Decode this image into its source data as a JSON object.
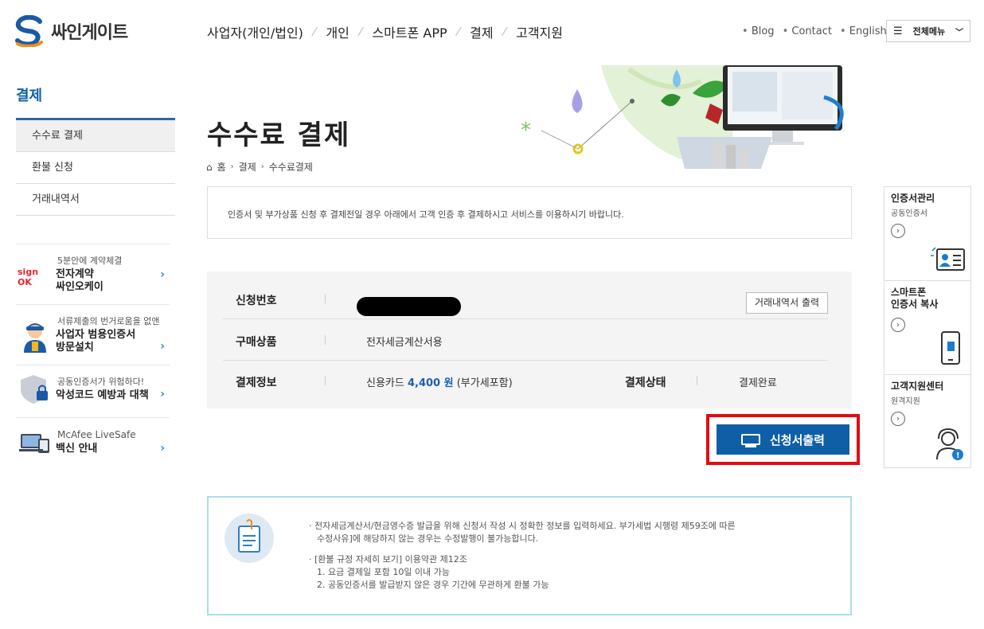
{
  "header": {
    "logo_text": "싸인게이트",
    "nav": [
      "사업자(개인/법인)",
      "개인",
      "스마트폰 APP",
      "결제",
      "고객지원"
    ],
    "util_links": [
      "Blog",
      "Contact",
      "English"
    ],
    "all_menu_label": "전체메뉴"
  },
  "sidebar": {
    "title": "결제",
    "items": [
      {
        "label": "수수료 결제"
      },
      {
        "label": "환불 신청"
      },
      {
        "label": "거래내역서"
      }
    ],
    "promos": [
      {
        "sub": "5분안에 계약체결",
        "main1": "전자계약",
        "main2": "싸인오케이",
        "icon_label": "sign OK"
      },
      {
        "sub": "서류제출의 번거로움을 없앤",
        "main1": "사업자 범용인증서",
        "main2": "방문설치"
      },
      {
        "sub": "공동인증서가 위험하다!",
        "main1": "악성코드 예방과 대책",
        "main2": ""
      },
      {
        "sub": "McAfee LiveSafe",
        "main1": "백신 안내",
        "main2": ""
      }
    ]
  },
  "page": {
    "title": "수수료 결제",
    "breadcrumb": [
      "홈",
      "결제",
      "수수료결제"
    ],
    "notice": "인증서 및 부가상품 신청 후 결제전일 경우 아래에서 고객 인증 후 결제하시고 서비스를 이용하시기 바랍니다."
  },
  "info": {
    "app_no_label": "신청번호",
    "history_button": "거래내역서 출력",
    "product_label": "구매상품",
    "product_value": "전자세금계산서용",
    "payment_label": "결제정보",
    "payment_method": "신용카드",
    "payment_amount": "4,400 원",
    "payment_note": "(부가세포함)",
    "status_label": "결제상태",
    "status_value": "결제완료"
  },
  "print_button": "신청서출력",
  "quick_menu": [
    {
      "title1": "인증서관리",
      "title2": "",
      "sub": "공동인증서"
    },
    {
      "title1": "스마트폰",
      "title2": "인증서 복사",
      "sub": ""
    },
    {
      "title1": "고객지원센터",
      "title2": "",
      "sub": "원격지원"
    }
  ],
  "guide": {
    "line1": "· 전자세금계산서/현금영수증 발급을 위해 신청서 작성 시 정확한 정보를 입력하세요. 부가세법 시행령 제59조에 따른",
    "line2": "수정사유]에 해당하지 않는 경우는 수정발행이 불가능합니다.",
    "line3": "· [환불 규정 자세히 보기] 이용약관 제12조",
    "line4": "1. 요금 결제일 포함 10일 이내 가능",
    "line5": "2. 공동인증서를 발급받지 않은 경우 기간에 무관하게 환불 가능"
  },
  "colors": {
    "brand_blue": "#0f5fa6",
    "highlight_red": "#e30b12",
    "sidebar_title": "#0b61a8",
    "guide_border": "#a8dfe6"
  }
}
